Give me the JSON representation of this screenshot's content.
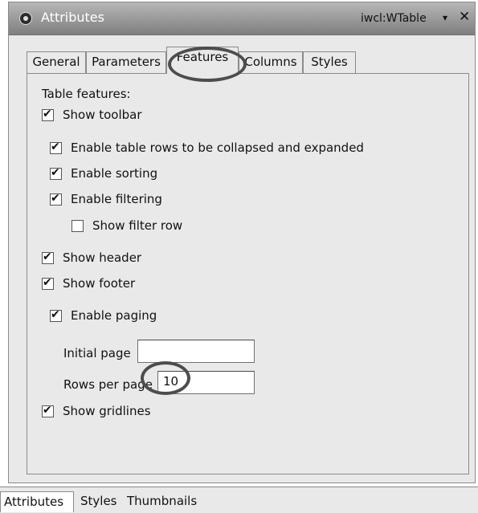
{
  "window": {
    "title": "Attributes",
    "right_title": "iwcl:WTable",
    "menu_glyph": "▾",
    "close_glyph": "✕"
  },
  "tabs": [
    {
      "label": "General"
    },
    {
      "label": "Parameters"
    },
    {
      "label": "Features",
      "active": true
    },
    {
      "label": "Columns"
    },
    {
      "label": "Styles"
    }
  ],
  "section_title": "Table features:",
  "options": [
    {
      "id": "show-toolbar",
      "label": "Show toolbar",
      "checked": true
    },
    {
      "id": "collapse-expand",
      "label": "Enable table rows to be collapsed and expanded",
      "checked": true
    },
    {
      "id": "enable-sorting",
      "label": "Enable sorting",
      "checked": true
    },
    {
      "id": "enable-filtering",
      "label": "Enable filtering",
      "checked": true
    },
    {
      "id": "show-filter-row",
      "label": "Show filter row",
      "checked": false
    },
    {
      "id": "show-header",
      "label": "Show header",
      "checked": true
    },
    {
      "id": "show-footer",
      "label": "Show footer",
      "checked": true
    },
    {
      "id": "enable-paging",
      "label": "Enable paging",
      "checked": true
    },
    {
      "id": "show-gridlines",
      "label": "Show gridlines",
      "checked": true
    }
  ],
  "fields": {
    "initial_page": {
      "label": "Initial page",
      "value": ""
    },
    "rows_per_page": {
      "label": "Rows per page",
      "value": "10"
    }
  },
  "bottom_tabs": [
    {
      "label": "Attributes",
      "active": true
    },
    {
      "label": "Styles"
    },
    {
      "label": "Thumbnails"
    }
  ]
}
